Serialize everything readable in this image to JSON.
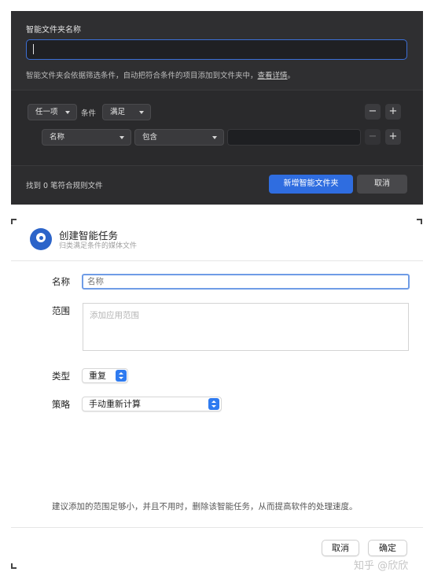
{
  "dark_dialog": {
    "title": "智能文件夹名称",
    "name_value": "",
    "description": "智能文件夹会依据筛选条件，自动把符合条件的项目添加到文件夹中，",
    "description_link": "查看详情",
    "description_end": "。",
    "match_select": "任一项",
    "condition_label": "条件",
    "satisfy_select": "满足",
    "rule_field_select": "名称",
    "rule_operator_select": "包含",
    "rule_value": "",
    "minus": "−",
    "plus": "+",
    "found_text": "找到 0 笔符合规则文件",
    "create_button": "新增智能文件夹",
    "cancel_button": "取消"
  },
  "task_dialog": {
    "title": "创建智能任务",
    "subtitle": "归类满足条件的媒体文件",
    "name_label": "名称",
    "name_placeholder": "名称",
    "range_label": "范围",
    "range_placeholder": "添加应用范围",
    "type_label": "类型",
    "type_value": "重复",
    "strategy_label": "策略",
    "strategy_value": "手动重新计算",
    "hint": "建议添加的范围足够小，并且不用时，删除该智能任务，从而提高软件的处理速度。",
    "cancel_button": "取消",
    "confirm_button": "确定"
  },
  "watermark": "知乎 @欣欣"
}
